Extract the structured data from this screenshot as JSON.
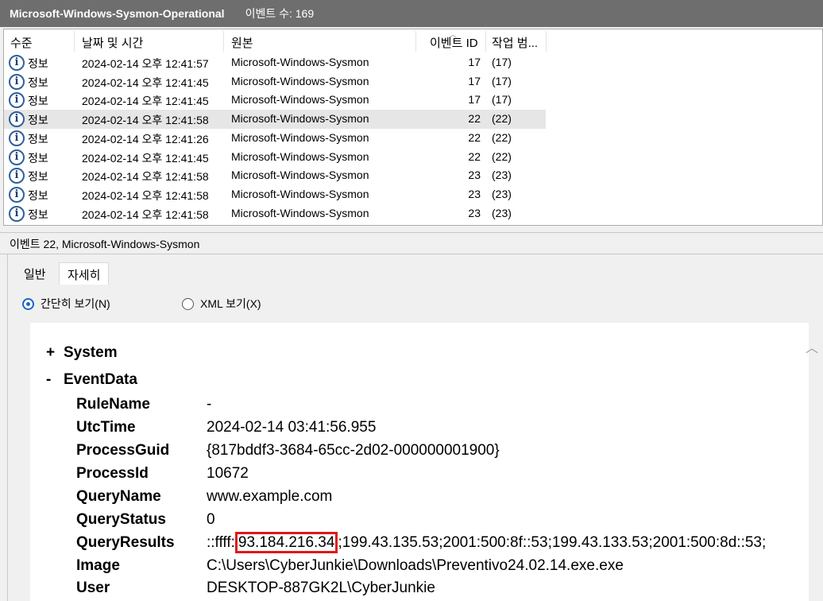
{
  "header": {
    "title": "Microsoft-Windows-Sysmon-Operational",
    "count": "이벤트 수: 169"
  },
  "columns": {
    "level": "수준",
    "datetime": "날짜 및 시간",
    "source": "원본",
    "event_id": "이벤트 ID",
    "task": "작업 범..."
  },
  "events": [
    {
      "level": "정보",
      "datetime": "2024-02-14 오후 12:41:57",
      "source": "Microsoft-Windows-Sysmon",
      "event_id": "17",
      "task": "(17)"
    },
    {
      "level": "정보",
      "datetime": "2024-02-14 오후 12:41:45",
      "source": "Microsoft-Windows-Sysmon",
      "event_id": "17",
      "task": "(17)"
    },
    {
      "level": "정보",
      "datetime": "2024-02-14 오후 12:41:45",
      "source": "Microsoft-Windows-Sysmon",
      "event_id": "17",
      "task": "(17)"
    },
    {
      "level": "정보",
      "datetime": "2024-02-14 오후 12:41:58",
      "source": "Microsoft-Windows-Sysmon",
      "event_id": "22",
      "task": "(22)"
    },
    {
      "level": "정보",
      "datetime": "2024-02-14 오후 12:41:26",
      "source": "Microsoft-Windows-Sysmon",
      "event_id": "22",
      "task": "(22)"
    },
    {
      "level": "정보",
      "datetime": "2024-02-14 오후 12:41:45",
      "source": "Microsoft-Windows-Sysmon",
      "event_id": "22",
      "task": "(22)"
    },
    {
      "level": "정보",
      "datetime": "2024-02-14 오후 12:41:58",
      "source": "Microsoft-Windows-Sysmon",
      "event_id": "23",
      "task": "(23)"
    },
    {
      "level": "정보",
      "datetime": "2024-02-14 오후 12:41:58",
      "source": "Microsoft-Windows-Sysmon",
      "event_id": "23",
      "task": "(23)"
    },
    {
      "level": "정보",
      "datetime": "2024-02-14 오후 12:41:58",
      "source": "Microsoft-Windows-Sysmon",
      "event_id": "23",
      "task": "(23)"
    }
  ],
  "details": {
    "title": "이벤트 22, Microsoft-Windows-Sysmon",
    "tabs": {
      "general": "일반",
      "detail": "자세히"
    },
    "view": {
      "friendly": "간단히 보기(N)",
      "xml": "XML 보기(X)"
    },
    "system": {
      "sign": "+",
      "label": "System"
    },
    "eventdata": {
      "sign": "-",
      "label": "EventData"
    },
    "fields": {
      "rulename": {
        "k": "RuleName",
        "v": "-"
      },
      "utctime": {
        "k": "UtcTime",
        "v": "2024-02-14 03:41:56.955"
      },
      "processguid": {
        "k": "ProcessGuid",
        "v": "{817bddf3-3684-65cc-2d02-000000001900}"
      },
      "processid": {
        "k": "ProcessId",
        "v": "10672"
      },
      "queryname": {
        "k": "QueryName",
        "v": "www.example.com"
      },
      "querystatus": {
        "k": "QueryStatus",
        "v": "0"
      },
      "queryresults": {
        "k": "QueryResults",
        "prefix": "::ffff:",
        "highlight": "93.184.216.34",
        "rest": ";199.43.135.53;2001:500:8f::53;199.43.133.53;2001:500:8d::53;"
      },
      "image": {
        "k": "Image",
        "v": "C:\\Users\\CyberJunkie\\Downloads\\Preventivo24.02.14.exe.exe"
      },
      "user": {
        "k": "User",
        "v": "DESKTOP-887GK2L\\CyberJunkie"
      }
    }
  },
  "colors": {
    "highlight_box": "#e01818",
    "selected_row": "#e6e6e6"
  }
}
